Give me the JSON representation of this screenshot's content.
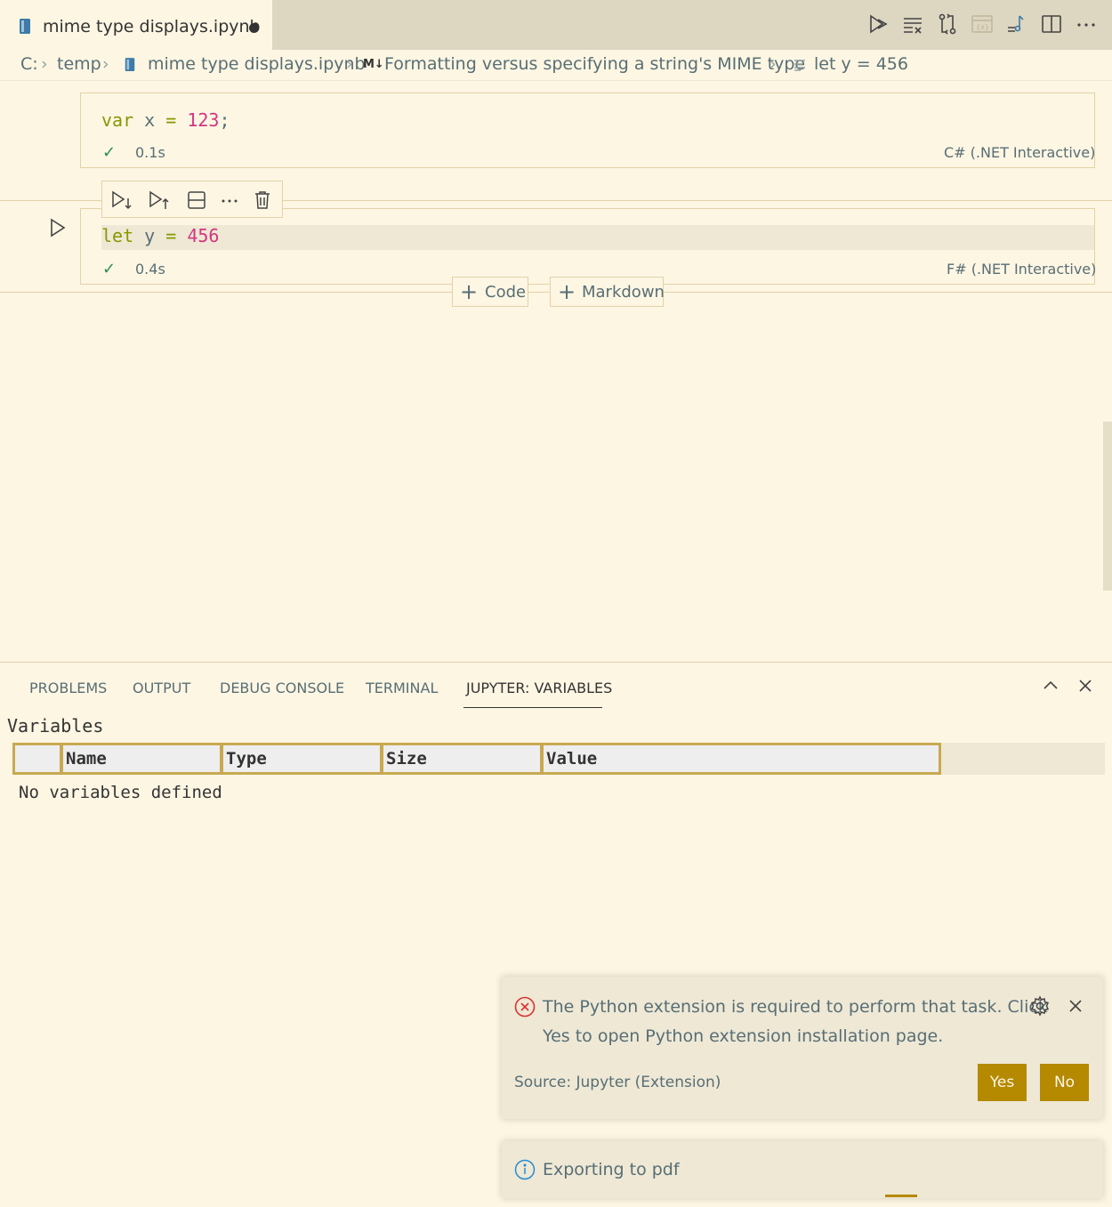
{
  "tab": {
    "title": "mime type displays.ipynb",
    "modified": true
  },
  "breadcrumb": {
    "drive": "C:",
    "folder": "temp",
    "file": "mime type displays.ipynb",
    "md_badge": "M↓",
    "section": "Formatting versus specifying a string's MIME type",
    "cell": "let y = 456"
  },
  "cells": [
    {
      "code": {
        "kw": "var",
        "ident": " x ",
        "op": "=",
        "num": " 123",
        "tail": ";"
      },
      "status_icon": "✓",
      "duration": "0.1s",
      "language": "C# (.NET Interactive)"
    },
    {
      "code": {
        "kw": "let",
        "ident": " y ",
        "op": "=",
        "num": " 456",
        "tail": ""
      },
      "status_icon": "✓",
      "duration": "0.4s",
      "language": "F# (.NET Interactive)"
    }
  ],
  "insert": {
    "code_label": "Code",
    "markdown_label": "Markdown",
    "plus": "+"
  },
  "panel": {
    "tabs": [
      "PROBLEMS",
      "OUTPUT",
      "DEBUG CONSOLE",
      "TERMINAL",
      "JUPYTER: VARIABLES"
    ],
    "active_tab": "JUPYTER: VARIABLES",
    "variables_title": "Variables",
    "columns": [
      "",
      "Name",
      "Type",
      "Size",
      "Value"
    ],
    "empty_message": "No variables defined"
  },
  "notifications": {
    "python": {
      "line1": "The Python extension is required to perform that task. Click",
      "line2": "Yes to open Python extension installation page.",
      "source": "Source: Jupyter (Extension)",
      "yes": "Yes",
      "no": "No"
    },
    "export": {
      "message": "Exporting to pdf"
    }
  },
  "icons": {
    "toolbar": [
      "run-all-icon",
      "clear-outputs-icon",
      "compare-icon",
      "variables-icon",
      "outline-icon",
      "split-editor-icon",
      "more-icon"
    ],
    "cell_toolbar": [
      "run-below-icon",
      "run-above-icon",
      "split-cell-icon",
      "more-icon",
      "delete-icon"
    ]
  },
  "colors": {
    "background": "#FDF6E3",
    "accent": "#B58900",
    "keyword": "#859900",
    "number": "#D33682"
  }
}
